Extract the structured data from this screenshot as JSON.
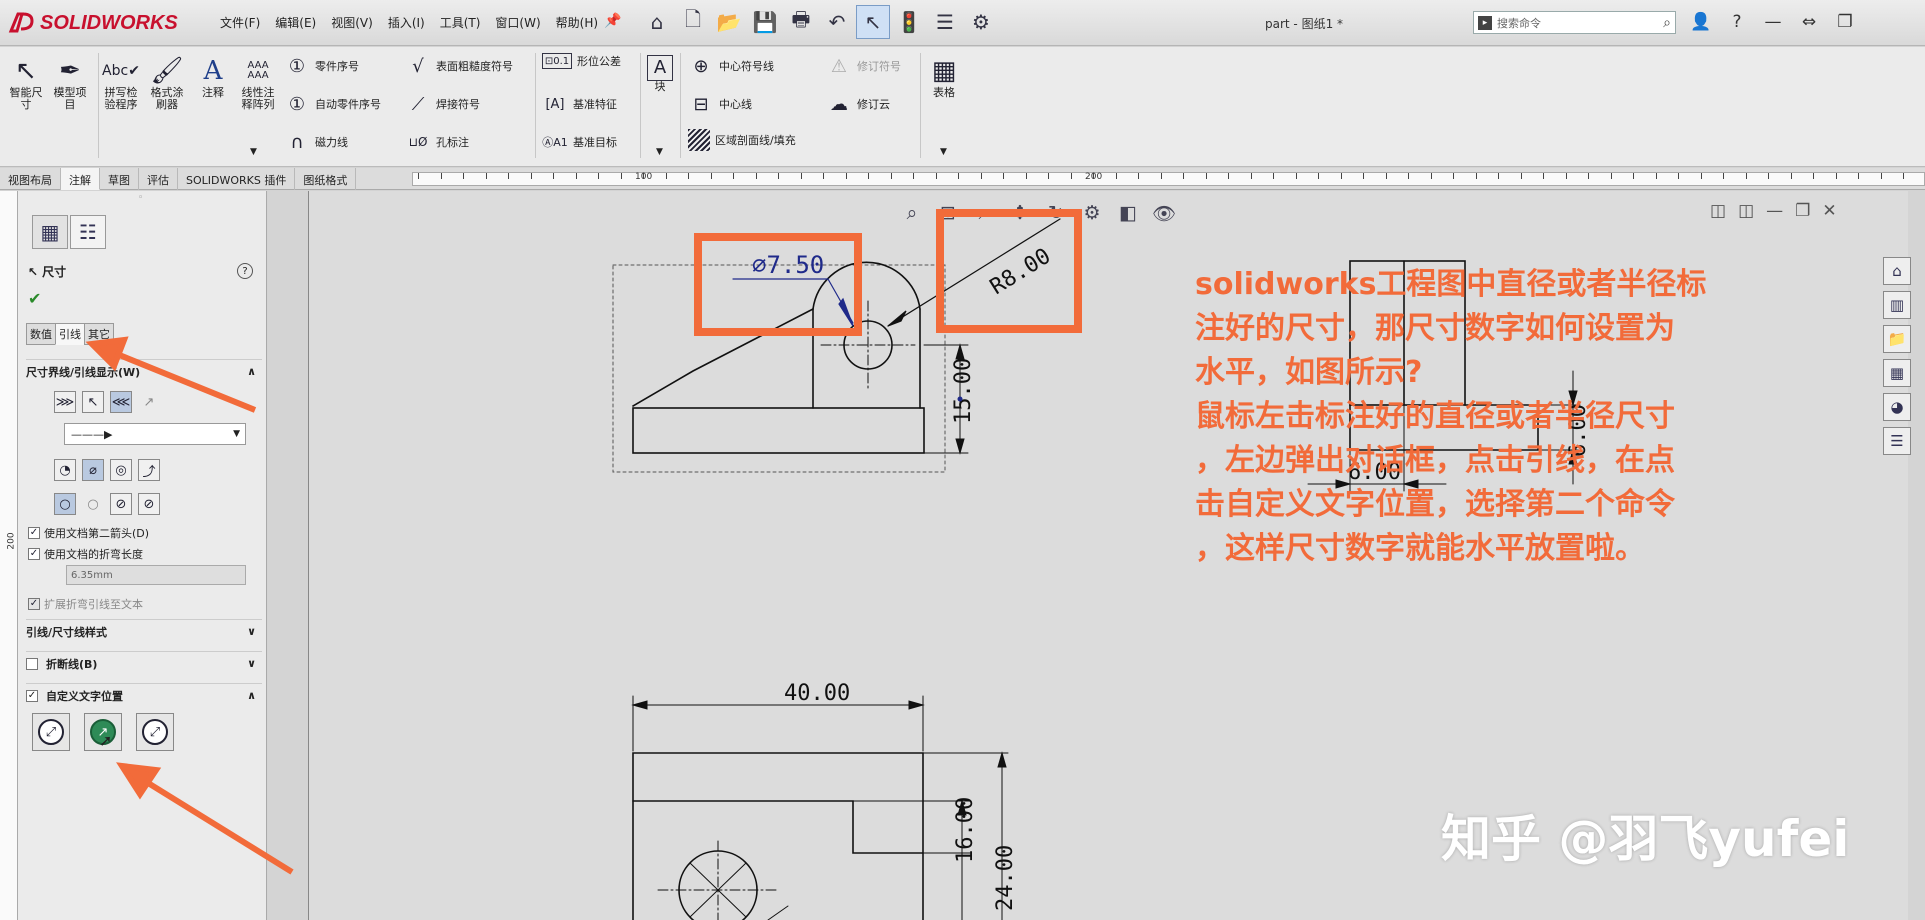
{
  "app": {
    "name": "SOLIDWORKS",
    "doc_title": "part - 图纸1 *"
  },
  "menu": [
    "文件(F)",
    "编辑(E)",
    "视图(V)",
    "插入(I)",
    "工具(T)",
    "窗口(W)",
    "帮助(H)"
  ],
  "search": {
    "placeholder": "搜索命令"
  },
  "ribbon": {
    "smart_dim": "智能尺\n寸",
    "model_items": "模型项\n目",
    "spell": "拼写检\n验程序",
    "format_painter": "格式涂\n刷器",
    "note": "注释",
    "linear_note": "线性注\n释阵列",
    "balloon": "零件序号",
    "auto_balloon": "自动零件序号",
    "magnetic_line": "磁力线",
    "surface_finish": "表面粗糙度符号",
    "weld": "焊接符号",
    "hole_callout": "孔标注",
    "gtol": "形位公差",
    "datum_feature": "基准特征",
    "datum_target": "基准目标",
    "block": "块",
    "center_mark": "中心符号线",
    "centerline": "中心线",
    "area_hatch": "区域剖面线/填充",
    "revision_symbol": "修订符号",
    "revision_cloud": "修订云",
    "table": "表格"
  },
  "tabs": [
    "视图布局",
    "注解",
    "草图",
    "评估",
    "SOLIDWORKS 插件",
    "图纸格式"
  ],
  "active_tab": "注解",
  "ruler": {
    "h": [
      "100",
      "200"
    ],
    "v": "200"
  },
  "panel": {
    "title": "尺寸",
    "help": "?",
    "subtabs": [
      "数值",
      "引线",
      "其它"
    ],
    "sec1": "尺寸界线/引线显示(W)",
    "arrow_style": "———▶",
    "cb_second_arrow": "使用文档第二箭头(D)",
    "cb_bent_length": "使用文档的折弯长度",
    "bent_length": "6.35mm",
    "cb_extend": "扩展折弯引线至文本",
    "sec2": "引线/尺寸线样式",
    "sec3": "折断线(B)",
    "sec4": "自定义文字位置"
  },
  "drawing": {
    "dim_dia": "⌀7.50",
    "dim_r": "R8.00",
    "dim_15": "15.00",
    "dim_6h": "6.00",
    "dim_6v": "6.00",
    "dim_40": "40.00",
    "dim_16": "16.00",
    "dim_24": "24.00"
  },
  "annotation": {
    "l1": "solidworks工程图中直径或者半径标",
    "l2": "注好的尺寸，那尺寸数字如何设置为",
    "l3": "水平，如图所示?",
    "l4": "鼠标左击标注好的直径或者半径尺寸",
    "l5": "，左边弹出对话框，点击引线，在点",
    "l6": "击自定义文字位置，选择第二个命令",
    "l7": "，这样尺寸数字就能水平放置啦。"
  },
  "watermark": "知乎 @羽飞yufei",
  "colors": {
    "accent": "#f26b3a",
    "dim_blue": "#1f2a8a",
    "brand": "#c8102e"
  }
}
